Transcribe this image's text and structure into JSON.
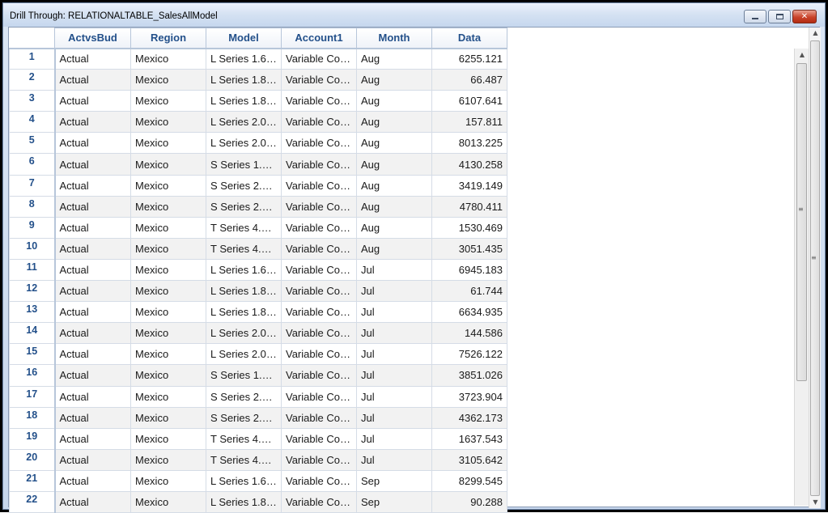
{
  "window": {
    "title": "Drill Through: RELATIONALTABLE_SalesAllModel",
    "minimize_icon": "minimize-icon",
    "maximize_icon": "maximize-icon",
    "close_glyph": "✕"
  },
  "table": {
    "columns": [
      "ActvsBud",
      "Region",
      "Model",
      "Account1",
      "Month",
      "Data"
    ],
    "rows": [
      {
        "n": "1",
        "c": [
          "Actual",
          "Mexico",
          "L Series 1.6…",
          "Variable Co…",
          "Aug",
          "6255.121"
        ]
      },
      {
        "n": "2",
        "c": [
          "Actual",
          "Mexico",
          "L Series 1.8…",
          "Variable Co…",
          "Aug",
          "66.487"
        ]
      },
      {
        "n": "3",
        "c": [
          "Actual",
          "Mexico",
          "L Series 1.8…",
          "Variable Co…",
          "Aug",
          "6107.641"
        ]
      },
      {
        "n": "4",
        "c": [
          "Actual",
          "Mexico",
          "L Series 2.0…",
          "Variable Co…",
          "Aug",
          "157.811"
        ]
      },
      {
        "n": "5",
        "c": [
          "Actual",
          "Mexico",
          "L Series 2.0…",
          "Variable Co…",
          "Aug",
          "8013.225"
        ]
      },
      {
        "n": "6",
        "c": [
          "Actual",
          "Mexico",
          "S Series 1.…",
          "Variable Co…",
          "Aug",
          "4130.258"
        ]
      },
      {
        "n": "7",
        "c": [
          "Actual",
          "Mexico",
          "S Series 2.…",
          "Variable Co…",
          "Aug",
          "3419.149"
        ]
      },
      {
        "n": "8",
        "c": [
          "Actual",
          "Mexico",
          "S Series 2.…",
          "Variable Co…",
          "Aug",
          "4780.411"
        ]
      },
      {
        "n": "9",
        "c": [
          "Actual",
          "Mexico",
          "T Series 4.…",
          "Variable Co…",
          "Aug",
          "1530.469"
        ]
      },
      {
        "n": "10",
        "c": [
          "Actual",
          "Mexico",
          "T Series 4.…",
          "Variable Co…",
          "Aug",
          "3051.435"
        ]
      },
      {
        "n": "11",
        "c": [
          "Actual",
          "Mexico",
          "L Series 1.6…",
          "Variable Co…",
          "Jul",
          "6945.183"
        ]
      },
      {
        "n": "12",
        "c": [
          "Actual",
          "Mexico",
          "L Series 1.8…",
          "Variable Co…",
          "Jul",
          "61.744"
        ]
      },
      {
        "n": "13",
        "c": [
          "Actual",
          "Mexico",
          "L Series 1.8…",
          "Variable Co…",
          "Jul",
          "6634.935"
        ]
      },
      {
        "n": "14",
        "c": [
          "Actual",
          "Mexico",
          "L Series 2.0…",
          "Variable Co…",
          "Jul",
          "144.586"
        ]
      },
      {
        "n": "15",
        "c": [
          "Actual",
          "Mexico",
          "L Series 2.0…",
          "Variable Co…",
          "Jul",
          "7526.122"
        ]
      },
      {
        "n": "16",
        "c": [
          "Actual",
          "Mexico",
          "S Series 1.…",
          "Variable Co…",
          "Jul",
          "3851.026"
        ]
      },
      {
        "n": "17",
        "c": [
          "Actual",
          "Mexico",
          "S Series 2.…",
          "Variable Co…",
          "Jul",
          "3723.904"
        ]
      },
      {
        "n": "18",
        "c": [
          "Actual",
          "Mexico",
          "S Series 2.…",
          "Variable Co…",
          "Jul",
          "4362.173"
        ]
      },
      {
        "n": "19",
        "c": [
          "Actual",
          "Mexico",
          "T Series 4.…",
          "Variable Co…",
          "Jul",
          "1637.543"
        ]
      },
      {
        "n": "20",
        "c": [
          "Actual",
          "Mexico",
          "T Series 4.…",
          "Variable Co…",
          "Jul",
          "3105.642"
        ]
      },
      {
        "n": "21",
        "c": [
          "Actual",
          "Mexico",
          "L Series 1.6…",
          "Variable Co…",
          "Sep",
          "8299.545"
        ]
      },
      {
        "n": "22",
        "c": [
          "Actual",
          "Mexico",
          "L Series 1.8…",
          "Variable Co…",
          "Sep",
          "90.288"
        ]
      }
    ]
  },
  "scrollbar": {
    "up_arrow": "▲",
    "down_arrow": "▼",
    "grip": "≡"
  }
}
